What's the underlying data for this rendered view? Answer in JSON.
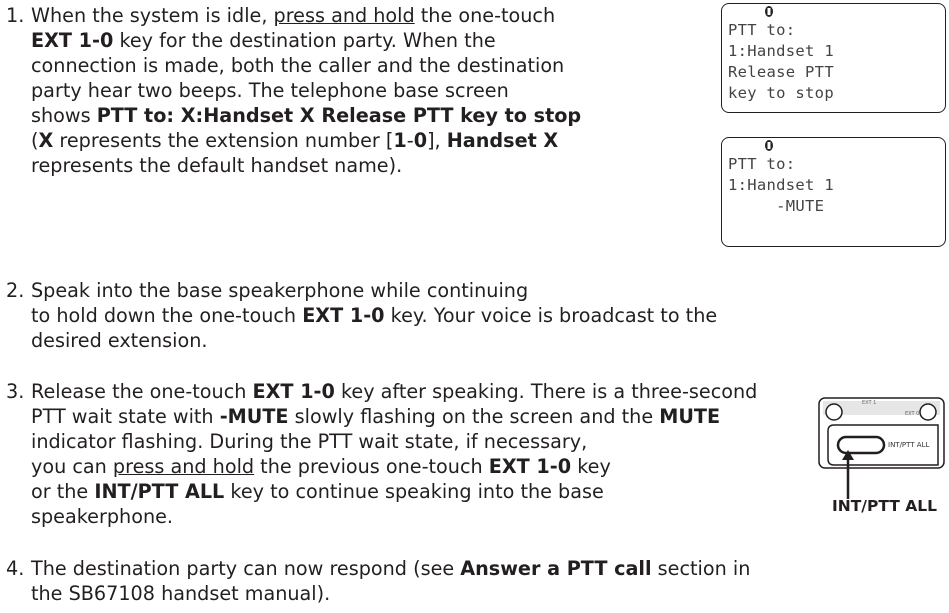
{
  "steps": [
    {
      "number": "1.",
      "lines": [
        [
          "When the system is idle, ",
          "<u>press and hold</u>",
          " the one-touch"
        ],
        [
          "<b>EXT 1-0</b> key for the destination party. When the"
        ],
        [
          "connection is made, both the caller and the destination"
        ],
        [
          "party hear two beeps. The telephone base screen"
        ],
        [
          "shows <b>PTT to: X:Handset X Release PTT key to stop</b>"
        ],
        [
          "(<b>X</b> represents the extension number [<b>1</b>-<b>0</b>], <b>Handset X</b>"
        ],
        [
          "represents the default handset name)."
        ]
      ]
    },
    {
      "number": "2.",
      "lines": [
        [
          "Speak into the base speakerphone while continuing"
        ],
        [
          "to hold down the one-touch <b>EXT 1-0</b> key. Your voice is broadcast to the"
        ],
        [
          "desired extension."
        ]
      ]
    },
    {
      "number": "3.",
      "lines": [
        [
          "Release the one-touch <b>EXT 1-0</b> key after speaking. There is a three-second"
        ],
        [
          "PTT wait state with <b>-MUTE</b> slowly flashing on the screen and the <b>MUTE</b>"
        ],
        [
          "indicator flashing. During the PTT wait state, if necessary,"
        ],
        [
          "you can <u>press and hold</u> the previous one-touch <b>EXT 1-0</b> key"
        ],
        [
          "or the <b>INT/PTT ALL</b> key to continue speaking into the base"
        ],
        [
          "speakerphone."
        ]
      ]
    },
    {
      "number": "4.",
      "lines": [
        [
          "The destination party can now respond (see <b>Answer a PTT call</b> section in"
        ],
        [
          "the SB67108 handset manual)."
        ]
      ]
    }
  ],
  "screen1": {
    "icon": "speaker-phone-icon",
    "lines": [
      "PTT to:",
      "1:Handset 1",
      "Release PTT",
      "key to stop"
    ]
  },
  "screen2": {
    "icon": "speaker-phone-icon",
    "lines": [
      "PTT to:",
      "1:Handset 1",
      "     -MUTE"
    ]
  },
  "button_figure": {
    "top_label_left": "EXT 1",
    "top_label_right": "EXT 0",
    "key_label": "INT/PTT ALL",
    "caption": "INT/PTT ALL"
  }
}
